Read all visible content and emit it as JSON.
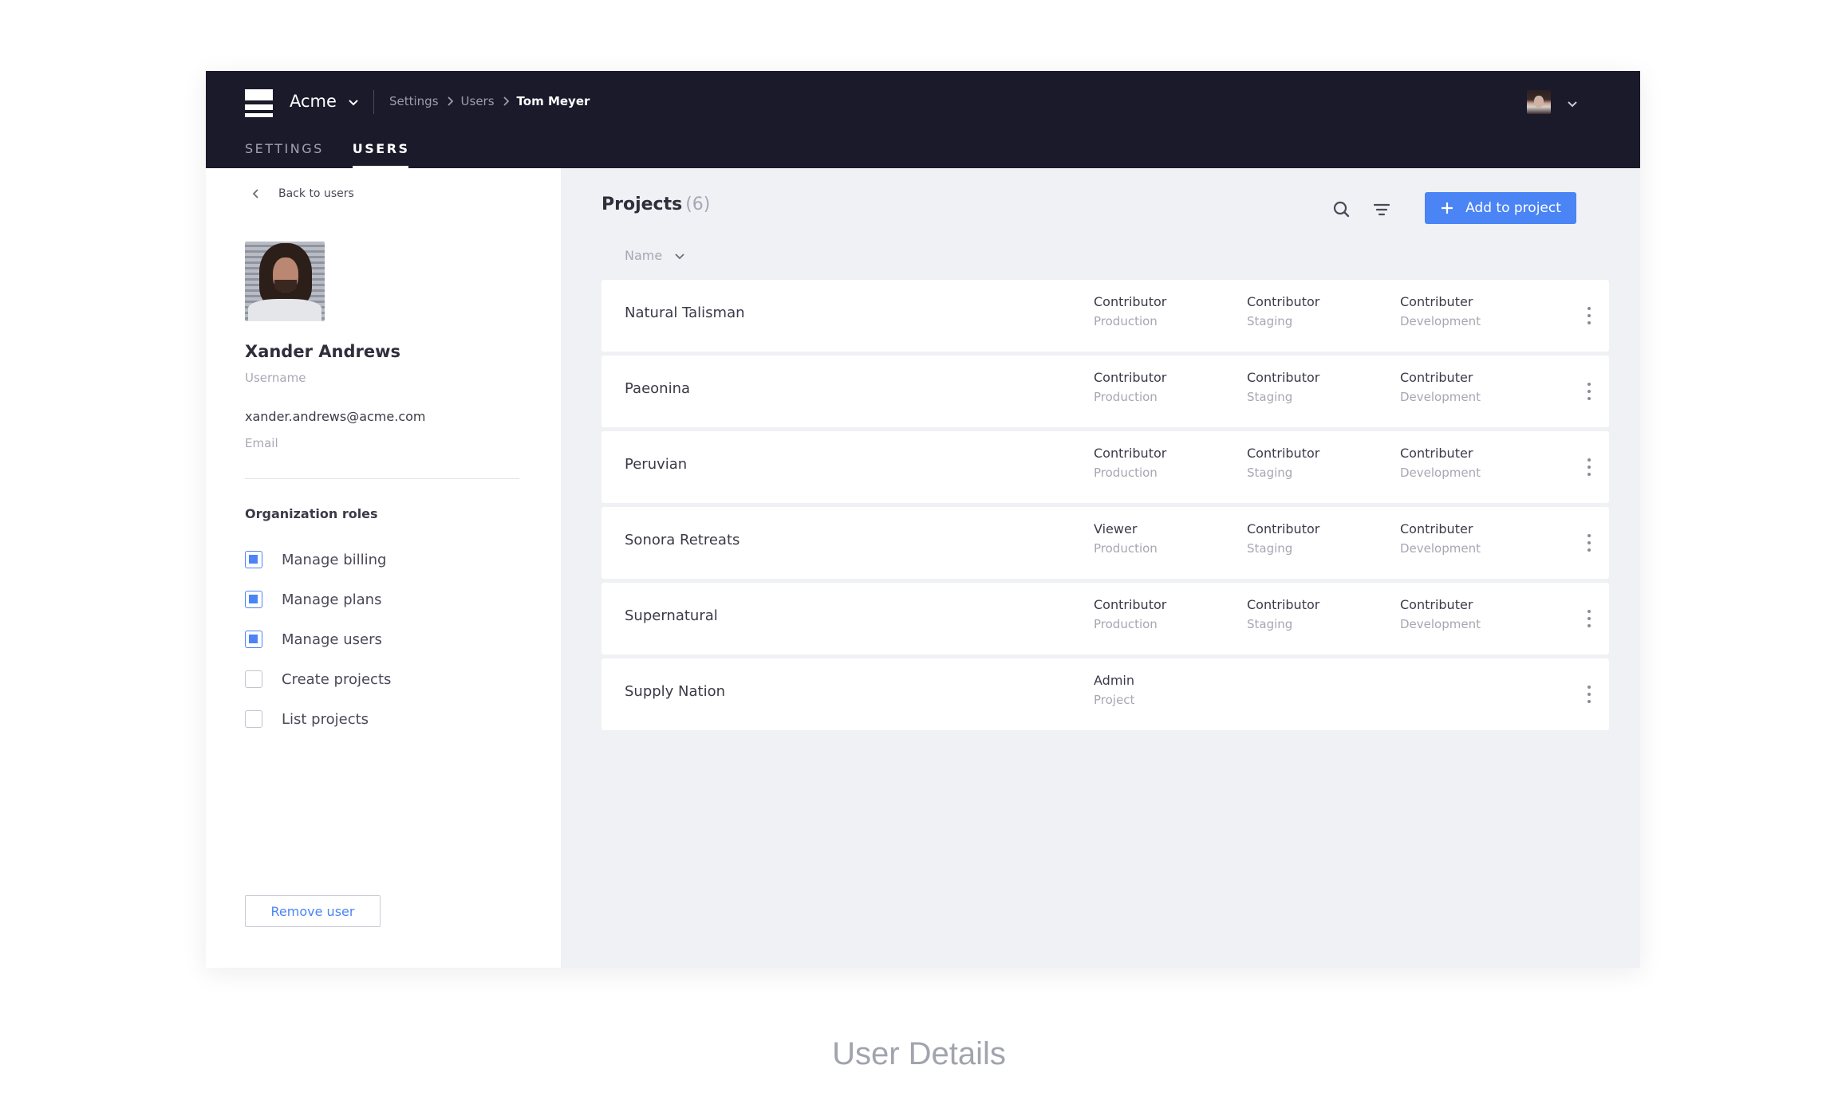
{
  "header": {
    "org_name": "Acme",
    "breadcrumb": [
      "Settings",
      "Users",
      "Tom Meyer"
    ],
    "tabs": [
      {
        "label": "SETTINGS",
        "active": false
      },
      {
        "label": "USERS",
        "active": true
      }
    ]
  },
  "sidebar": {
    "back_label": "Back to users",
    "user_name": "Xander Andrews",
    "username_label": "Username",
    "email": "xander.andrews@acme.com",
    "email_label": "Email",
    "roles_title": "Organization roles",
    "roles": [
      {
        "label": "Manage billing",
        "checked": true
      },
      {
        "label": "Manage plans",
        "checked": true
      },
      {
        "label": "Manage users",
        "checked": true
      },
      {
        "label": "Create projects",
        "checked": false
      },
      {
        "label": "List projects",
        "checked": false
      }
    ],
    "remove_label": "Remove user"
  },
  "projects": {
    "title": "Projects",
    "count": "(6)",
    "add_label": "Add to project",
    "sort_label": "Name",
    "rows": [
      {
        "name": "Natural Talisman",
        "roles": [
          {
            "role": "Contributor",
            "env": "Production"
          },
          {
            "role": "Contributor",
            "env": "Staging"
          },
          {
            "role": "Contributer",
            "env": "Development"
          }
        ]
      },
      {
        "name": "Paeonina",
        "roles": [
          {
            "role": "Contributor",
            "env": "Production"
          },
          {
            "role": "Contributor",
            "env": "Staging"
          },
          {
            "role": "Contributer",
            "env": "Development"
          }
        ]
      },
      {
        "name": "Peruvian",
        "roles": [
          {
            "role": "Contributor",
            "env": "Production"
          },
          {
            "role": "Contributor",
            "env": "Staging"
          },
          {
            "role": "Contributer",
            "env": "Development"
          }
        ]
      },
      {
        "name": "Sonora Retreats",
        "roles": [
          {
            "role": "Viewer",
            "env": "Production"
          },
          {
            "role": "Contributor",
            "env": "Staging"
          },
          {
            "role": "Contributer",
            "env": "Development"
          }
        ]
      },
      {
        "name": "Supernatural",
        "roles": [
          {
            "role": "Contributor",
            "env": "Production"
          },
          {
            "role": "Contributor",
            "env": "Staging"
          },
          {
            "role": "Contributer",
            "env": "Development"
          }
        ]
      },
      {
        "name": "Supply Nation",
        "roles": [
          {
            "role": "Admin",
            "env": "Project"
          }
        ]
      }
    ]
  },
  "colors": {
    "header_bg": "#1b1a2b",
    "accent": "#4a84f5",
    "page_bg": "#f0f1f5"
  },
  "caption": "User Details"
}
